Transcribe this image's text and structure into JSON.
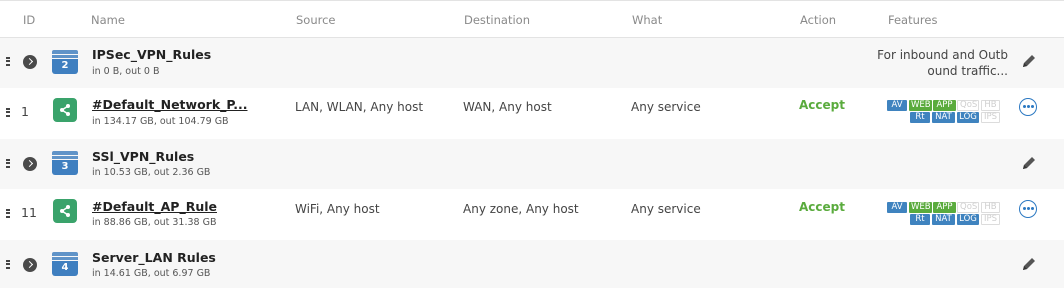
{
  "columns": {
    "id": "ID",
    "name": "Name",
    "source": "Source",
    "destination": "Destination",
    "what": "What",
    "action": "Action",
    "features": "Features"
  },
  "rows": [
    {
      "kind": "group",
      "group_number": "2",
      "name": "IPSec_VPN_Rules",
      "traffic": "in 0 B, out 0 B",
      "description_line1": "For inbound and Outb",
      "description_line2": "ound traffic..."
    },
    {
      "kind": "rule",
      "id": "1",
      "name": "#Default_Network_P...",
      "traffic": "in 134.17 GB, out 104.79 GB",
      "source": "LAN, WLAN, Any host",
      "destination": "WAN, Any host",
      "what": "Any service",
      "action": "Accept"
    },
    {
      "kind": "group",
      "group_number": "3",
      "name": "SSl_VPN_Rules",
      "traffic": "in 10.53 GB, out 2.36 GB"
    },
    {
      "kind": "rule",
      "id": "11",
      "name": "#Default_AP_Rule",
      "traffic": "in 88.86 GB, out 31.38 GB",
      "source": "WiFi, Any host",
      "destination": "Any zone, Any host",
      "what": "Any service",
      "action": "Accept"
    },
    {
      "kind": "group",
      "group_number": "4",
      "name": "Server_LAN Rules",
      "traffic": "in 14.61 GB, out 6.97 GB"
    }
  ],
  "feature_badges": {
    "av": "AV",
    "web": "WEB",
    "app": "APP",
    "qos": "QoS",
    "hb": "HB",
    "rt": "Rt",
    "nat": "NAT",
    "log": "LOG",
    "ips": "IPS"
  },
  "colors": {
    "accept": "#5aab3d",
    "badge_blue": "#3f83bf",
    "badge_green": "#5aab3d",
    "group_icon": "#3f7fc0",
    "rule_icon": "#3aa36b",
    "more_icon": "#2b78c2"
  },
  "icons": {
    "group": "stacked-layers-icon",
    "rule": "share-icon",
    "edit": "pencil-icon",
    "more": "more-options-icon"
  }
}
